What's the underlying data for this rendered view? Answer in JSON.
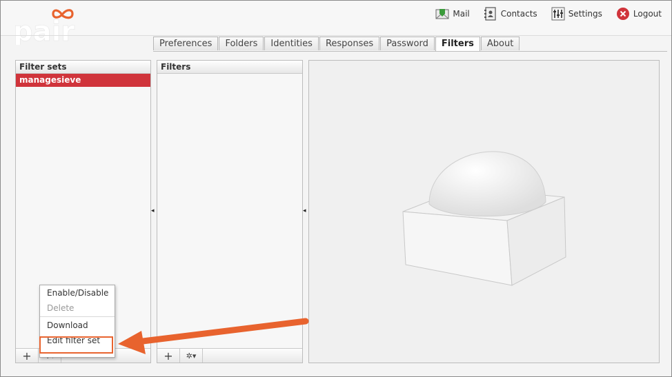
{
  "logo": {
    "text": "pair"
  },
  "topnav": {
    "mail": "Mail",
    "contacts": "Contacts",
    "settings": "Settings",
    "logout": "Logout"
  },
  "tabs": [
    {
      "label": "Preferences",
      "active": false
    },
    {
      "label": "Folders",
      "active": false
    },
    {
      "label": "Identities",
      "active": false
    },
    {
      "label": "Responses",
      "active": false
    },
    {
      "label": "Password",
      "active": false
    },
    {
      "label": "Filters",
      "active": true
    },
    {
      "label": "About",
      "active": false
    }
  ],
  "filter_sets": {
    "title": "Filter sets",
    "items": [
      "managesieve"
    ],
    "add_label": "+"
  },
  "filters": {
    "title": "Filters",
    "add_label": "+"
  },
  "context_menu": {
    "items": [
      {
        "label": "Enable/Disable",
        "enabled": true
      },
      {
        "label": "Delete",
        "enabled": false
      },
      {
        "label": "Download",
        "enabled": true
      },
      {
        "label": "Edit filter set",
        "enabled": true
      }
    ]
  },
  "colors": {
    "brand": "#d0343b",
    "annotation": "#e8632e"
  }
}
